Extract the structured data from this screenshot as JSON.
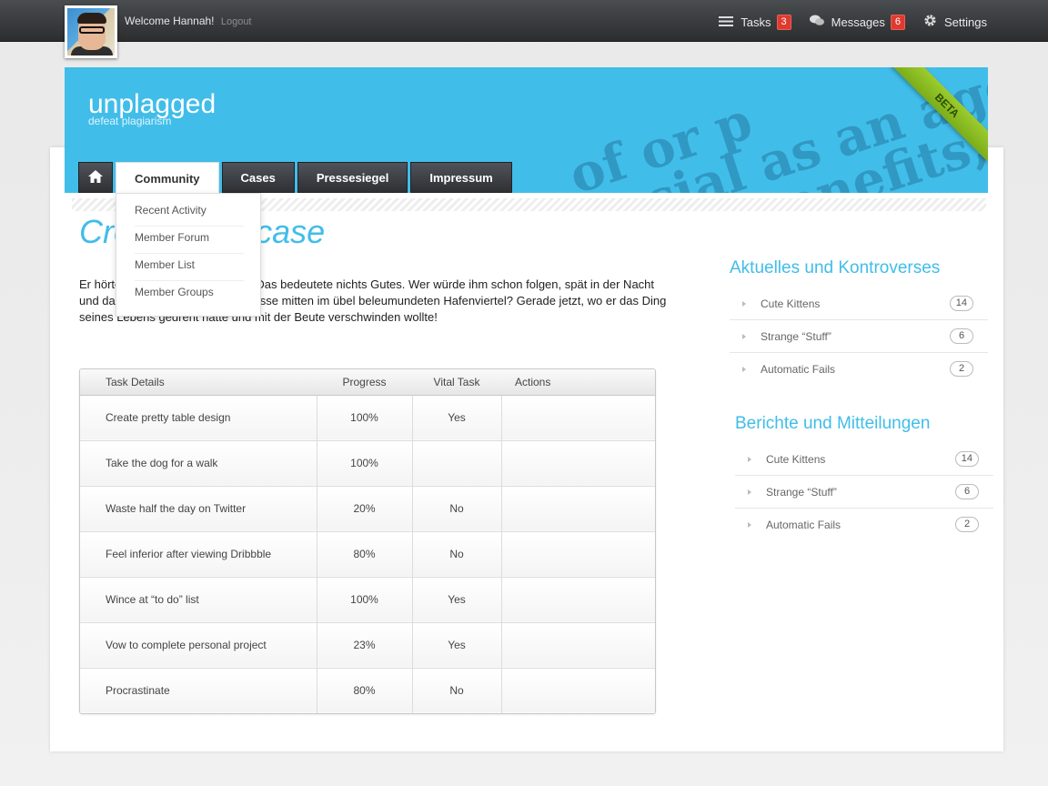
{
  "user": {
    "welcome": "Welcome Hannah!",
    "logout": "Logout"
  },
  "top_nav": [
    {
      "label": "Tasks",
      "badge": "3",
      "icon": "list-icon"
    },
    {
      "label": "Messages",
      "badge": "6",
      "icon": "chat-icon"
    },
    {
      "label": "Settings",
      "badge": "",
      "icon": "gear-icon"
    }
  ],
  "brand": {
    "name": "unplagged",
    "tagline": "defeat plagiarism",
    "ribbon": "BETA",
    "banner_words": [
      "of or p",
      "social as an aggr",
      "ublic benefits; so"
    ]
  },
  "tabs": [
    "Community",
    "Cases",
    "Pressesiegel",
    "Impressum"
  ],
  "dropdown": [
    "Recent Activity",
    "Member Forum",
    "Member List",
    "Member Groups"
  ],
  "page_title": "Create new case",
  "intro": "Er hörte leise Schritte hinter sich. Das bedeutete nichts Gutes. Wer würde ihm schon folgen, spät in der Nacht und dazu noch in dieser engen Gasse mitten im übel beleumundeten Hafenviertel? Gerade jetzt, wo er das Ding seines Lebens gedreht hatte und mit der Beute verschwinden wollte!",
  "table": {
    "headers": [
      "Task Details",
      "Progress",
      "Vital Task",
      "Actions"
    ],
    "rows": [
      [
        "Create pretty table design",
        "100%",
        "Yes",
        ""
      ],
      [
        "Take the dog for a walk",
        "100%",
        "",
        ""
      ],
      [
        "Waste half the day on Twitter",
        "20%",
        "No",
        ""
      ],
      [
        "Feel inferior after viewing Dribbble",
        "80%",
        "No",
        ""
      ],
      [
        "Wince at “to do” list",
        "100%",
        "Yes",
        ""
      ],
      [
        "Vow to complete personal project",
        "23%",
        "Yes",
        ""
      ],
      [
        "Procrastinate",
        "80%",
        "No",
        ""
      ]
    ]
  },
  "sidebar": [
    {
      "title": "Aktuelles und Kontroverses",
      "items": [
        {
          "label": "Cute Kittens",
          "count": "14"
        },
        {
          "label": "Strange “Stuff”",
          "count": "6"
        },
        {
          "label": "Automatic Fails",
          "count": "2"
        }
      ]
    },
    {
      "title": "Berichte und Mitteilungen",
      "items": [
        {
          "label": "Cute Kittens",
          "count": "14"
        },
        {
          "label": "Strange “Stuff”",
          "count": "6"
        },
        {
          "label": "Automatic Fails",
          "count": "2"
        }
      ]
    }
  ],
  "colors": {
    "accent": "#41bde9",
    "badge": "#e03a2f",
    "ribbon": "#8dc027"
  }
}
